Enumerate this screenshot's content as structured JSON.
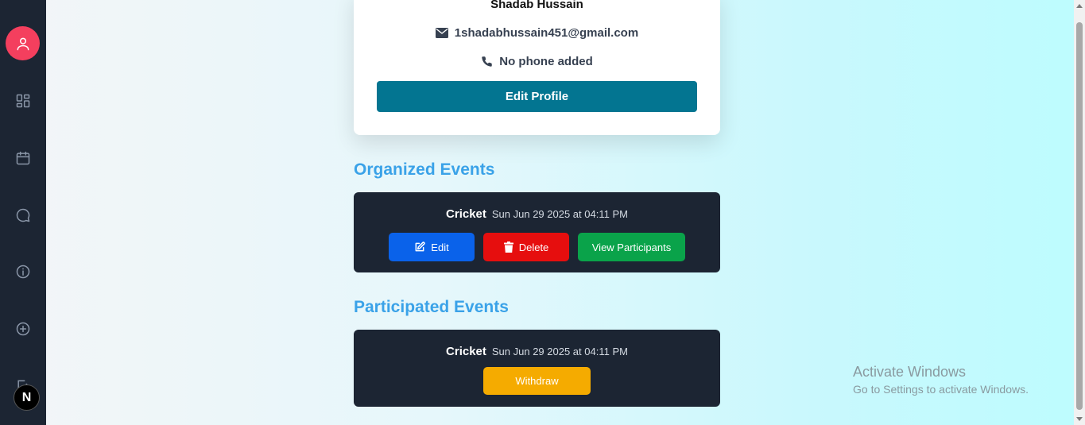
{
  "sidebar": {
    "items": [
      {
        "icon": "user-icon"
      },
      {
        "icon": "dashboard-icon"
      },
      {
        "icon": "calendar-icon"
      },
      {
        "icon": "chat-icon"
      },
      {
        "icon": "info-icon"
      },
      {
        "icon": "add-circle-icon"
      },
      {
        "icon": "logout-icon"
      }
    ],
    "badge_label": "N"
  },
  "profile": {
    "name": "Shadab Hussain",
    "email": "1shadabhussain451@gmail.com",
    "phone": "No phone added",
    "edit_button": "Edit Profile"
  },
  "organized": {
    "title": "Organized Events",
    "events": [
      {
        "name": "Cricket",
        "date": "Sun Jun 29 2025 at 04:11 PM",
        "edit_label": "Edit",
        "delete_label": "Delete",
        "view_label": "View Participants"
      }
    ]
  },
  "participated": {
    "title": "Participated Events",
    "events": [
      {
        "name": "Cricket",
        "date": "Sun Jun 29 2025 at 04:11 PM",
        "withdraw_label": "Withdraw"
      }
    ]
  },
  "watermark": {
    "line1": "Activate Windows",
    "line2": "Go to Settings to activate Windows."
  },
  "colors": {
    "sidebar_bg": "#1c2533",
    "avatar_bg": "#f43f5e",
    "primary_teal": "#037591",
    "heading_blue": "#3aa2e8",
    "edit_blue": "#0a62ea",
    "delete_red": "#e60e0e",
    "view_green": "#0aa34a",
    "withdraw_amber": "#f5ab00"
  }
}
